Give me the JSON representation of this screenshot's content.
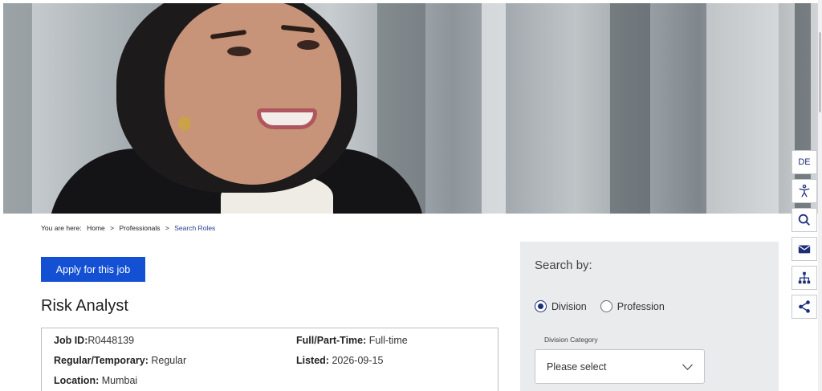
{
  "breadcrumb": {
    "prefix": "You are here:",
    "items": [
      "Home",
      "Professionals",
      "Search Roles"
    ]
  },
  "apply_button": "Apply for this job",
  "job": {
    "title": "Risk Analyst",
    "id_label": "Job ID:",
    "id_value": "R0448139",
    "type_label": "Regular/Temporary:",
    "type_value": "Regular",
    "location_label": "Location:",
    "location_value": "Mumbai",
    "time_label": "Full/Part-Time:",
    "time_value": "Full-time",
    "listed_label": "Listed:",
    "listed_value": "2026-09-15"
  },
  "search": {
    "heading": "Search by:",
    "options": [
      "Division",
      "Profession"
    ],
    "selected": "Division",
    "category_label": "Division Category",
    "select_value": "Please select"
  },
  "toolbar": {
    "language": "DE",
    "icons": [
      "accessibility-icon",
      "search-icon",
      "mail-icon",
      "sitemap-icon",
      "share-icon"
    ]
  },
  "colors": {
    "accent": "#1450d4",
    "navy": "#1c2d7a",
    "panel": "#eaebec"
  }
}
